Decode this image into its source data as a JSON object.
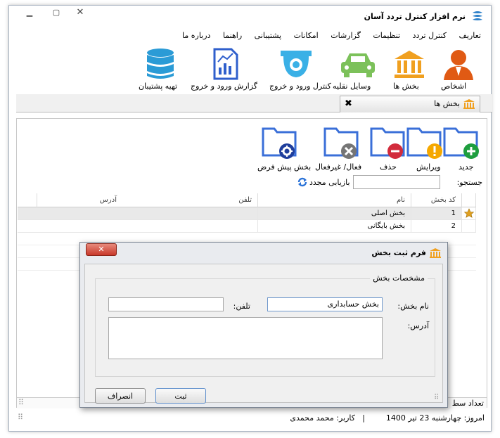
{
  "app": {
    "title": "نرم افزار کنترل تردد آسان"
  },
  "menu": [
    "تعاریف",
    "کنترل تردد",
    "تنظیمات",
    "گزارشات",
    "امکانات",
    "پشتیبانی",
    "راهنما",
    "درباره ما"
  ],
  "ribbon": {
    "persons": "اشخاص",
    "sections": "بخش ها",
    "vehicles": "وسایل نقلیه",
    "entry_control": "کنترل ورود و خروج",
    "entry_report": "گزارش ورود و خروج",
    "backup": "تهیه پشتیبان"
  },
  "tab": {
    "label": "بخش ها"
  },
  "toolbar": {
    "new": "جدید",
    "edit": "ویرایش",
    "delete": "حذف",
    "toggle": "فعال/ غیرفعال",
    "default": "بخش پیش فرض"
  },
  "search": {
    "label": "جستجو:",
    "value": "",
    "reset": "بازیابی مجدد"
  },
  "grid": {
    "columns": {
      "code": "کد بخش",
      "name": "نام",
      "phone": "تلفن",
      "address": "آدرس"
    },
    "rows": [
      {
        "code": "1",
        "name": "بخش اصلی",
        "phone": "",
        "address": ""
      },
      {
        "code": "2",
        "name": "بخش بایگانی",
        "phone": "",
        "address": ""
      }
    ]
  },
  "status": {
    "count_label": "تعداد سط",
    "date": "امروز: چهارشنبه 23 تیر 1400",
    "separator": "|",
    "user": "کاربر: محمد محمدی"
  },
  "dialog": {
    "title": "فرم ثبت بخش",
    "group_title": "مشخصات بخش",
    "name_label": "نام بخش:",
    "name_value": "بخش حسابداری",
    "phone_label": "تلفن:",
    "phone_value": "",
    "address_label": "آدرس:",
    "address_value": "",
    "save": "ثبت",
    "cancel": "انصراف"
  },
  "colors": {
    "folder": "#3a6fd8",
    "bank": "#f0a020",
    "person": "#e05a14",
    "car": "#7cc15a",
    "camera": "#3ab0e6",
    "report": "#2f5fcc",
    "database": "#2b9bd6",
    "close_red": "#c8382a"
  }
}
